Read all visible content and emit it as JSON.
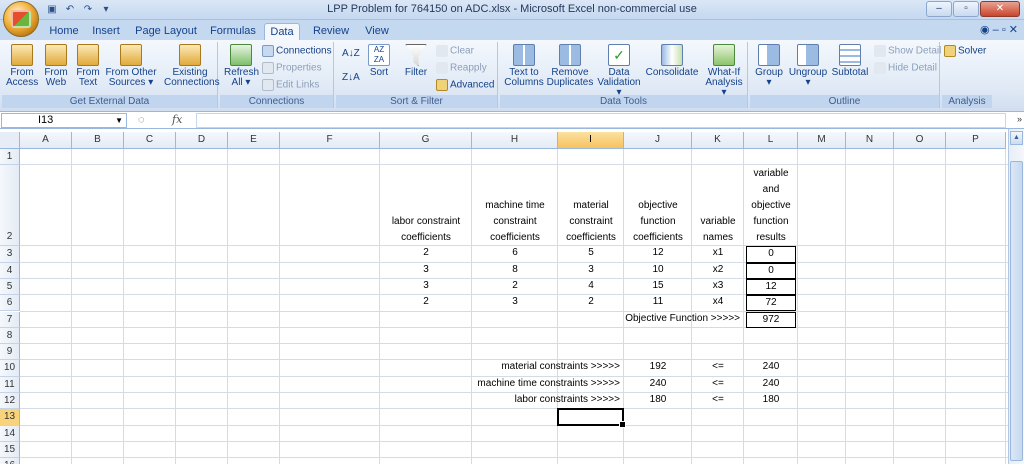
{
  "window": {
    "title": "LPP Problem for 764150 on ADC.xlsx - Microsoft Excel non-commercial use"
  },
  "tabs": [
    "Home",
    "Insert",
    "Page Layout",
    "Formulas",
    "Data",
    "Review",
    "View"
  ],
  "ribbon": {
    "get_external": {
      "label": "Get External Data",
      "buttons": [
        [
          "From",
          "Access"
        ],
        [
          "From",
          "Web"
        ],
        [
          "From",
          "Text"
        ],
        [
          "From Other",
          "Sources ▾"
        ],
        [
          "Existing",
          "Connections"
        ]
      ]
    },
    "connections": {
      "label": "Connections",
      "refresh": [
        "Refresh",
        "All ▾"
      ],
      "items": [
        "Connections",
        "Properties",
        "Edit Links"
      ]
    },
    "sort_filter": {
      "label": "Sort & Filter",
      "sort": "Sort",
      "filter": "Filter",
      "items": [
        "Clear",
        "Reapply",
        "Advanced"
      ]
    },
    "data_tools": {
      "label": "Data Tools",
      "buttons": [
        [
          "Text to",
          "Columns"
        ],
        [
          "Remove",
          "Duplicates"
        ],
        [
          "Data",
          "Validation ▾"
        ],
        [
          "Consolidate",
          ""
        ],
        [
          "What-If",
          "Analysis ▾"
        ]
      ]
    },
    "outline": {
      "label": "Outline",
      "buttons": [
        [
          "Group",
          "▾"
        ],
        [
          "Ungroup",
          "▾"
        ],
        [
          "Subtotal",
          ""
        ]
      ],
      "items": [
        "Show Detail",
        "Hide Detail"
      ]
    },
    "analysis": {
      "label": "Analysis",
      "solver": "Solver"
    }
  },
  "formula_bar": {
    "name_box": "I13",
    "fx": "fx",
    "value": ""
  },
  "columns": [
    "A",
    "B",
    "C",
    "D",
    "E",
    "F",
    "G",
    "H",
    "I",
    "J",
    "K",
    "L",
    "M",
    "N",
    "O",
    "P"
  ],
  "rows": [
    "1",
    "2",
    "3",
    "4",
    "5",
    "6",
    "7",
    "8",
    "9",
    "10",
    "11",
    "12",
    "13",
    "14",
    "15",
    "16"
  ],
  "headers": {
    "G": [
      "labor constraint",
      "coefficients"
    ],
    "H": [
      "machine time",
      "constraint",
      "coefficients"
    ],
    "I": [
      "material",
      "constraint",
      "coefficients"
    ],
    "J": [
      "objective",
      "function",
      "coefficients"
    ],
    "K": [
      "variable",
      "names"
    ],
    "L": [
      "variable",
      "and",
      "objective",
      "function",
      "results"
    ]
  },
  "table": [
    {
      "g": "2",
      "h": "6",
      "i": "5",
      "j": "12",
      "k": "x1",
      "l": "0"
    },
    {
      "g": "3",
      "h": "8",
      "i": "3",
      "j": "10",
      "k": "x2",
      "l": "0"
    },
    {
      "g": "3",
      "h": "2",
      "i": "4",
      "j": "15",
      "k": "x3",
      "l": "12"
    },
    {
      "g": "2",
      "h": "3",
      "i": "2",
      "j": "11",
      "k": "x4",
      "l": "72"
    }
  ],
  "objective": {
    "label": "Objective Function >>>>>",
    "value": "972"
  },
  "constraints": [
    {
      "label": "material constraints >>>>>",
      "lhs": "192",
      "op": "<=",
      "rhs": "240"
    },
    {
      "label": "machine time constraints >>>>>",
      "lhs": "240",
      "op": "<=",
      "rhs": "240"
    },
    {
      "label": "labor constraints >>>>>",
      "lhs": "180",
      "op": "<=",
      "rhs": "180"
    }
  ]
}
